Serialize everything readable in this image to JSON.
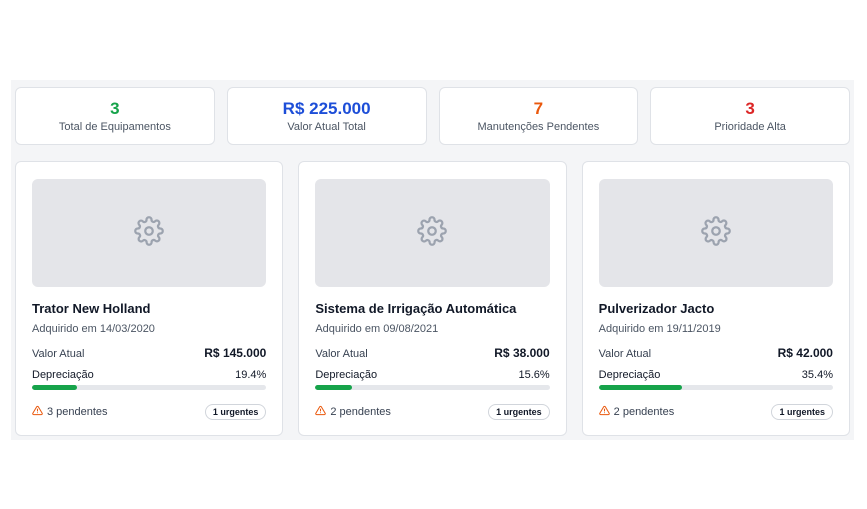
{
  "stats": [
    {
      "value": "3",
      "label": "Total de Equipamentos",
      "color": "#16a34a"
    },
    {
      "value": "R$ 225.000",
      "label": "Valor Atual Total",
      "color": "#1d4ed8"
    },
    {
      "value": "7",
      "label": "Manutenções Pendentes",
      "color": "#ea580c"
    },
    {
      "value": "3",
      "label": "Prioridade Alta",
      "color": "#dc2626"
    }
  ],
  "equipment": [
    {
      "image_icon": "gear-icon",
      "name": "Trator New Holland",
      "acquired": "Adquirido em 14/03/2020",
      "value_label": "Valor Atual",
      "value": "R$ 145.000",
      "depreciation_label": "Depreciação",
      "depreciation": "19.4%",
      "depreciation_fraction": 0.194,
      "pending_icon": "warning-icon",
      "pending": "3 pendentes",
      "urgent": "1 urgentes"
    },
    {
      "image_icon": "gear-icon",
      "name": "Sistema de Irrigação Automática",
      "acquired": "Adquirido em 09/08/2021",
      "value_label": "Valor Atual",
      "value": "R$ 38.000",
      "depreciation_label": "Depreciação",
      "depreciation": "15.6%",
      "depreciation_fraction": 0.156,
      "pending_icon": "warning-icon",
      "pending": "2 pendentes",
      "urgent": "1 urgentes"
    },
    {
      "image_icon": "gear-icon",
      "name": "Pulverizador Jacto",
      "acquired": "Adquirido em 19/11/2019",
      "value_label": "Valor Atual",
      "value": "R$ 42.000",
      "depreciation_label": "Depreciação",
      "depreciation": "35.4%",
      "depreciation_fraction": 0.354,
      "pending_icon": "warning-icon",
      "pending": "2 pendentes",
      "urgent": "1 urgentes"
    }
  ],
  "colors": {
    "progress": "#16a34a",
    "warning": "#ea580c"
  }
}
